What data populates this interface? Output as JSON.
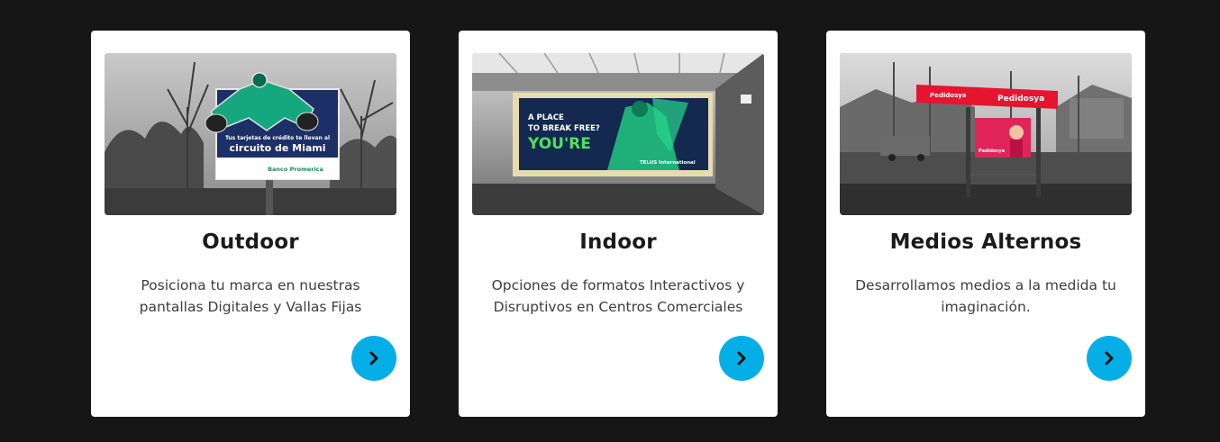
{
  "cards": [
    {
      "title": "Outdoor",
      "description": "Posiciona tu marca en nuestras pantallas Digitales y Vallas Fijas",
      "image": {
        "headline": "Tus tarjetas de crédito te llevan al",
        "big_text": "circuito de Miami",
        "brand": "Banco Promerica"
      },
      "button_icon": "chevron-right-icon"
    },
    {
      "title": "Indoor",
      "description": "Opciones de formatos Interactivos y Disruptivos en Centros Comerciales",
      "image": {
        "line1": "A PLACE",
        "line2": "TO BREAK FREE?",
        "line3": "YOU'RE",
        "brand": "TELUS International"
      },
      "button_icon": "chevron-right-icon"
    },
    {
      "title": "Medios Alternos",
      "description": "Desarrollamos medios a la medida tu imaginación.",
      "image": {
        "roof_brand": "Pedidosya",
        "ad_text": "Pedidosya"
      },
      "button_icon": "chevron-right-icon"
    }
  ],
  "colors": {
    "background": "#161616",
    "card": "#ffffff",
    "button": "#06aee8"
  }
}
